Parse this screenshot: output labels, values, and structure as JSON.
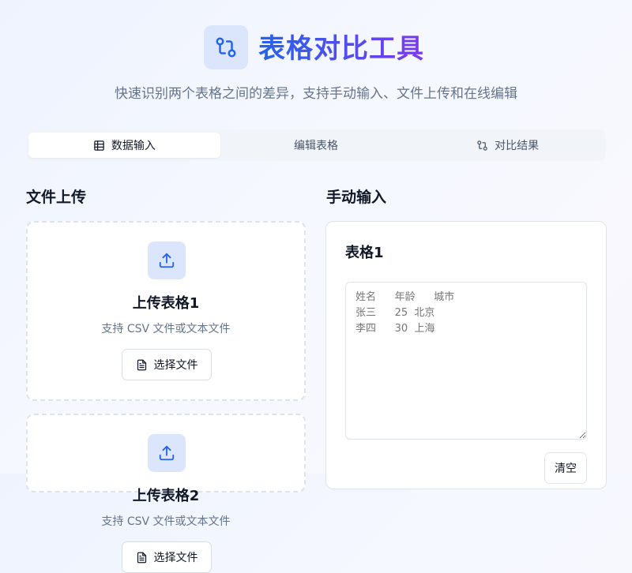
{
  "header": {
    "logo_icon": "git-compare-icon",
    "title": "表格对比工具",
    "subtitle": "快速识别两个表格之间的差异，支持手动输入、文件上传和在线编辑"
  },
  "tabs": [
    {
      "label": "数据输入",
      "icon": "table-icon",
      "active": true
    },
    {
      "label": "编辑表格",
      "icon": "",
      "active": false
    },
    {
      "label": "对比结果",
      "icon": "git-compare-icon",
      "active": false
    }
  ],
  "file_upload": {
    "section_title": "文件上传",
    "cards": [
      {
        "title": "上传表格1",
        "hint": "支持 CSV 文件或文本文件",
        "button_label": "选择文件",
        "icon": "upload-icon"
      },
      {
        "title": "上传表格2",
        "hint": "支持 CSV 文件或文本文件",
        "button_label": "选择文件",
        "icon": "upload-icon"
      }
    ]
  },
  "manual_input": {
    "section_title": "手动输入",
    "card_title": "表格1",
    "textarea_placeholder": "姓名\t年龄\t城市\n张三\t25\t北京\n李四\t30\t上海",
    "clear_button_label": "清空"
  },
  "colors": {
    "brand_gradient_start": "#2563eb",
    "brand_gradient_end": "#7c3aed",
    "icon_tile_bg": "#dbe6fd",
    "muted_text": "#64748b"
  }
}
